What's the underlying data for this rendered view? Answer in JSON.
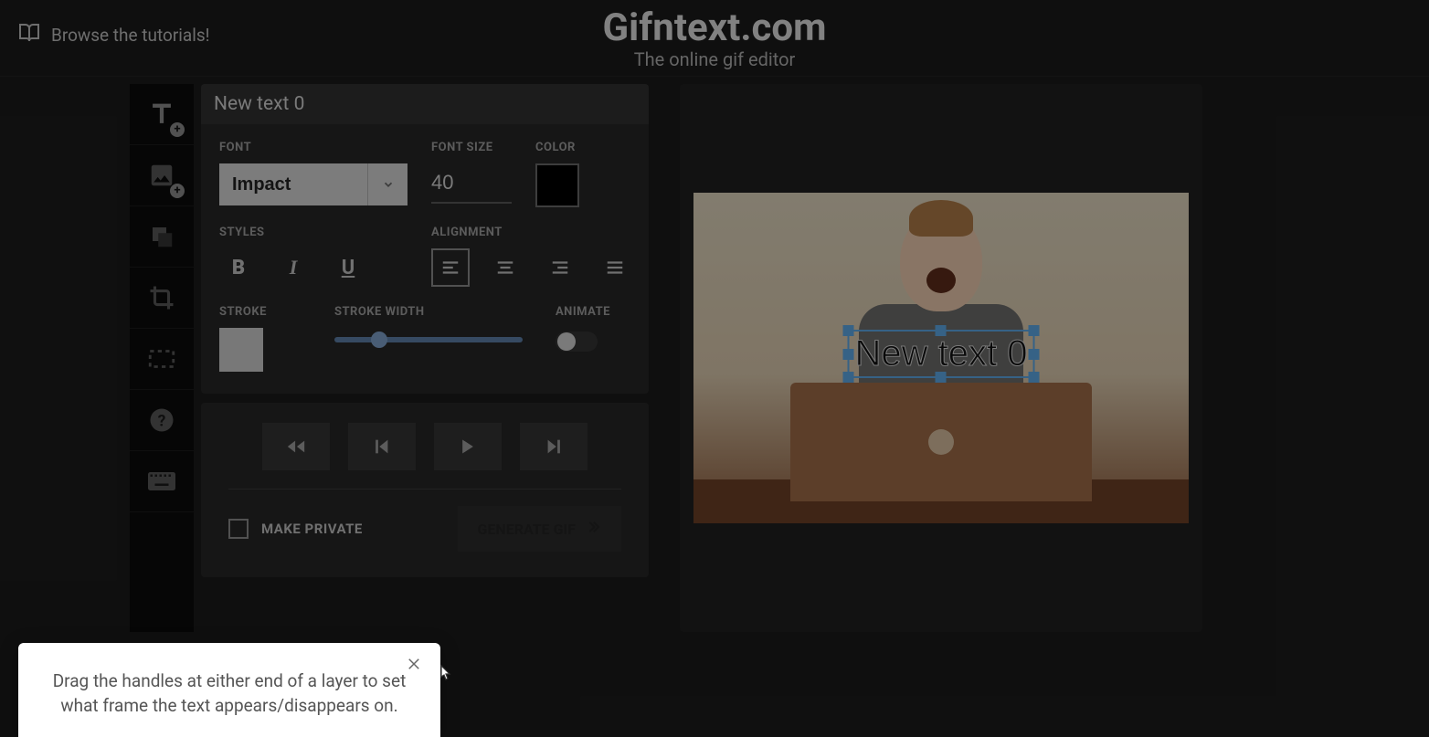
{
  "header": {
    "tutorials_label": "Browse the tutorials!",
    "brand_title": "Gifntext.com",
    "brand_subtitle": "The online gif editor"
  },
  "panel": {
    "title": "New text 0",
    "labels": {
      "font": "FONT",
      "font_size": "FONT SIZE",
      "color": "COLOR",
      "styles": "STYLES",
      "alignment": "ALIGNMENT",
      "stroke": "STROKE",
      "stroke_width": "STROKE WIDTH",
      "animate": "ANIMATE"
    },
    "font_name": "Impact",
    "font_size": "40",
    "color": "#000000",
    "stroke_color": "#c8c8c8"
  },
  "controls": {
    "make_private": "MAKE PRIVATE",
    "generate": "GENERATE GIF"
  },
  "canvas": {
    "text_overlay": "New text 0"
  },
  "tooltip": {
    "text": "Drag the handles at either end of a layer to set what frame the text appears/disappears on."
  }
}
